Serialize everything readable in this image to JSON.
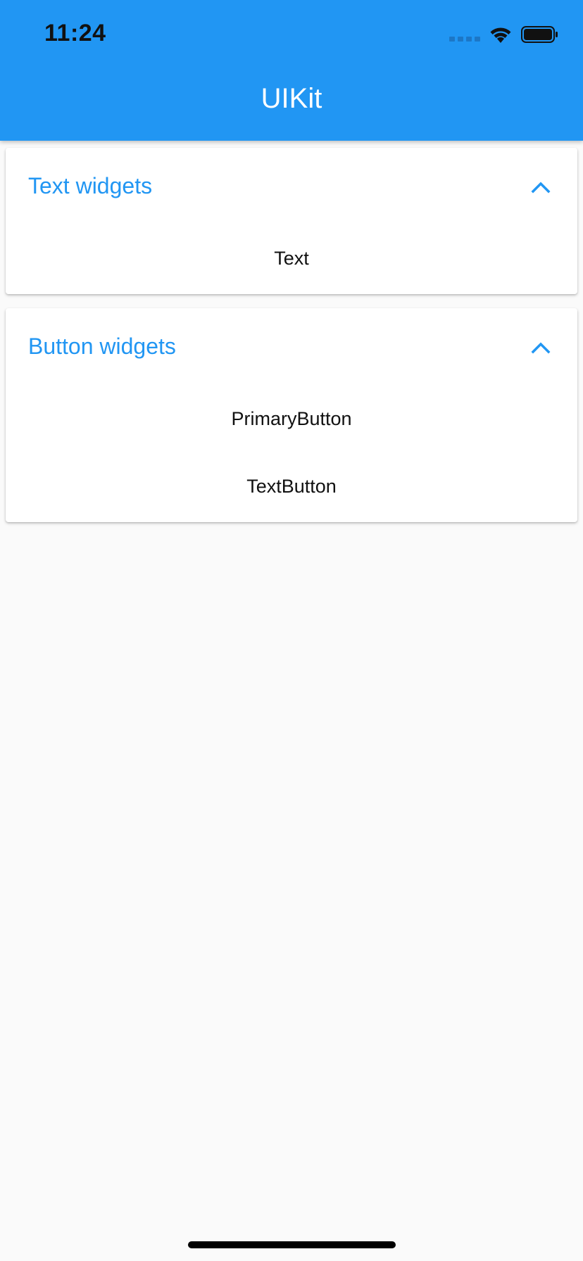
{
  "status_bar": {
    "time": "11:24"
  },
  "app_bar": {
    "title": "UIKit",
    "color": "#2196f3"
  },
  "panels": [
    {
      "title": "Text widgets",
      "expanded": true,
      "icon": "chevron-up-icon",
      "items": [
        "Text"
      ]
    },
    {
      "title": "Button widgets",
      "expanded": true,
      "icon": "chevron-up-icon",
      "items": [
        "PrimaryButton",
        "TextButton"
      ]
    }
  ]
}
